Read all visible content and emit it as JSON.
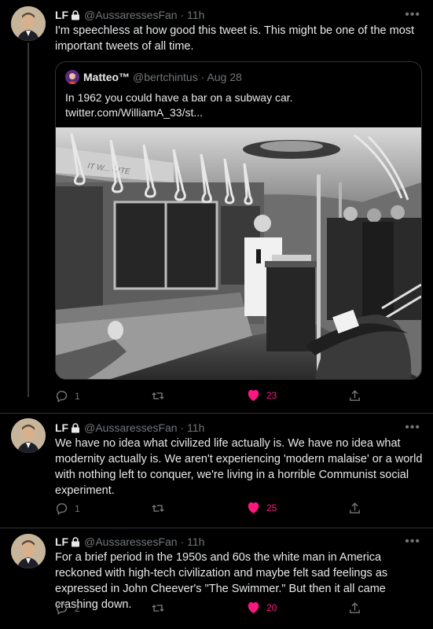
{
  "tweets": [
    {
      "display_name": "LF",
      "handle": "@AussaressesFan",
      "time": "· 11h",
      "text": "I'm speechless at how good this tweet is. This might be one of the most important tweets of all time.",
      "quote": {
        "display_name": "Matteo™",
        "handle": "@bertchintus",
        "time": "· Aug 28",
        "text_line1": "In 1962 you could have a bar on a subway car.",
        "text_line2": "twitter.com/WilliamA_33/st...",
        "image_sign": "IT W... CITE"
      },
      "replies": "1",
      "retweets": "",
      "likes": "23"
    },
    {
      "display_name": "LF",
      "handle": "@AussaressesFan",
      "time": "· 11h",
      "text": "We have no idea what civilized life actually is. We have no idea what modernity actually is. We aren't experiencing 'modern malaise' or a world with nothing left to conquer, we're living in a horrible Communist social experiment.",
      "replies": "1",
      "retweets": "",
      "likes": "25"
    },
    {
      "display_name": "LF",
      "handle": "@AussaressesFan",
      "time": "· 11h",
      "text": "For a brief period in the 1950s and 60s the white man in America reckoned with high-tech civilization and maybe felt sad feelings as expressed in John Cheever's \"The Swimmer.\" But then it all came crashing down.",
      "replies": "2",
      "retweets": "",
      "likes": "20"
    }
  ],
  "icons": {
    "reply": "reply-icon",
    "retweet": "retweet-icon",
    "like": "heart-icon",
    "share": "share-icon",
    "more": "more-icon",
    "lock": "lock-icon"
  },
  "colors": {
    "background": "#000000",
    "text": "#e7e9ea",
    "muted": "#71767b",
    "like": "#f91880",
    "border": "#2f3336"
  }
}
